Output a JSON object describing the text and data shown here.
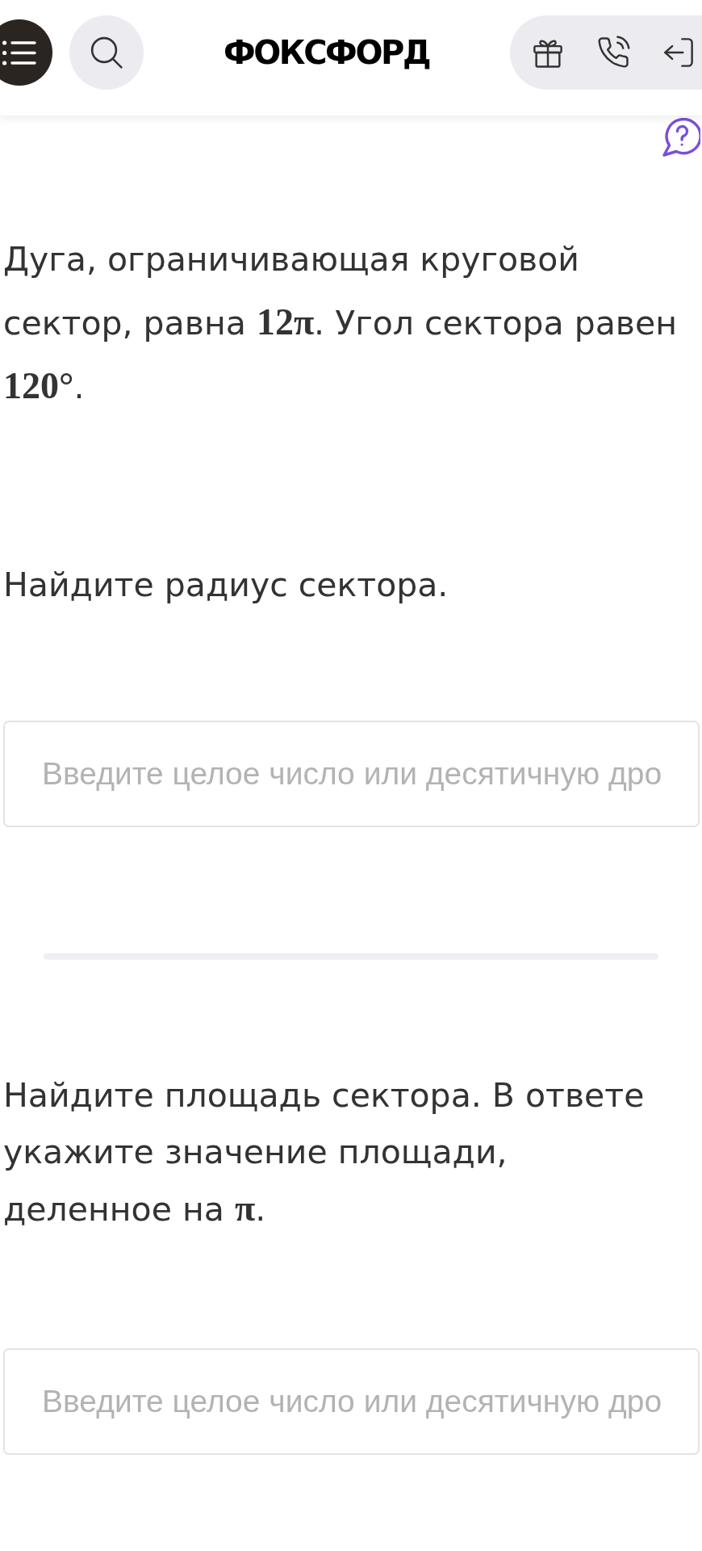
{
  "header": {
    "logo": "ФОКСФОРД"
  },
  "problem": {
    "statement": "Дуга, ограничивающая круговой\nсектор, равна **12π**. Угол сектора равен\n**120°**.",
    "parts": [
      {
        "question": "Найдите радиус сектора.",
        "answer": {
          "placeholder": "Введите целое число или десятичную дро"
        }
      },
      {
        "question": "Найдите площадь сектора. В ответе\nукажите значение площади,\nделенное на **π**.",
        "answer": {
          "placeholder": "Введите целое число или десятичную дро"
        }
      }
    ]
  }
}
